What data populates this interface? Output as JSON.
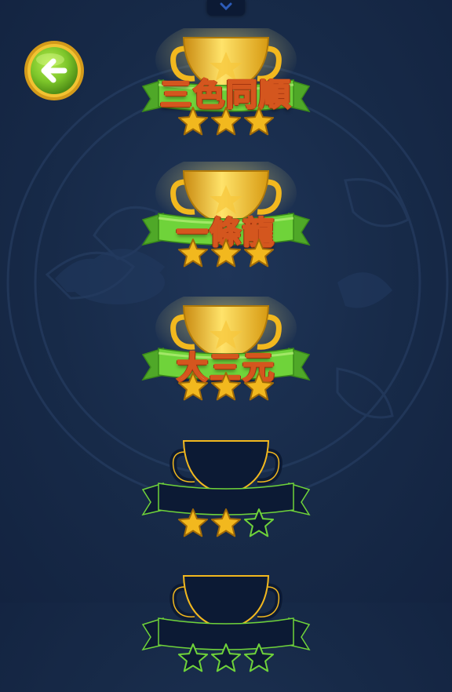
{
  "navigation": {
    "back_icon": "arrow-left-icon",
    "top_tab_icon": "chevron-down-icon"
  },
  "achievements": [
    {
      "title": "三色同順",
      "stars_earned": 3,
      "stars_total": 3,
      "unlocked": true
    },
    {
      "title": "一條龍",
      "stars_earned": 3,
      "stars_total": 3,
      "unlocked": true
    },
    {
      "title": "大三元",
      "stars_earned": 3,
      "stars_total": 3,
      "unlocked": true
    },
    {
      "title": "",
      "stars_earned": 2,
      "stars_total": 3,
      "unlocked": false
    },
    {
      "title": "",
      "stars_earned": 0,
      "stars_total": 3,
      "unlocked": false
    }
  ],
  "colors": {
    "background": "#172a48",
    "gold": "#f2b81e",
    "ribbon_green": "#6fd33a",
    "back_button_green": "#7cc52a",
    "locked_outline": "#6fd33a"
  }
}
